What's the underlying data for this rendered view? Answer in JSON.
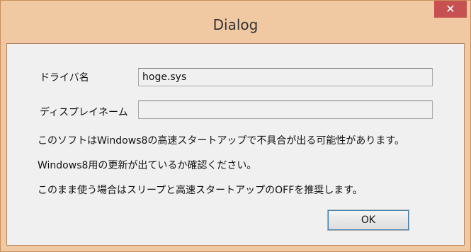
{
  "window": {
    "title": "Dialog",
    "close_glyph": "✕"
  },
  "form": {
    "driver_label": "ドライバ名",
    "driver_value": "hoge.sys",
    "display_label": "ディスプレイネーム",
    "display_value": ""
  },
  "message": {
    "line1": "このソフトはWindows8の高速スタートアップで不具合が出る可能性があります。",
    "line2": "Windows8用の更新が出ているか確認ください。",
    "line3": "このまま使う場合はスリープと高速スタートアップのOFFを推奨します。"
  },
  "buttons": {
    "ok": "OK"
  },
  "colors": {
    "frame": "#f0c9a3",
    "client": "#f0f0f0",
    "close": "#c75050"
  },
  "icons": {
    "close": "close-icon"
  }
}
